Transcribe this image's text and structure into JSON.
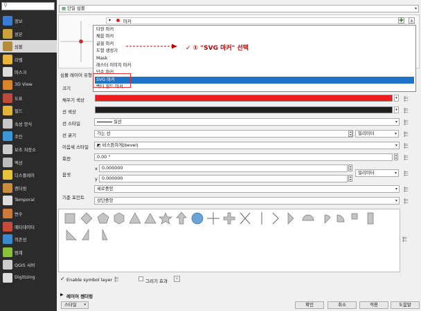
{
  "sidebar": {
    "items": [
      {
        "label": "정보",
        "icon": "info-icon",
        "color": "#3a7bd5"
      },
      {
        "label": "원본",
        "icon": "source-icon",
        "color": "#c9a23a"
      },
      {
        "label": "심볼",
        "icon": "symbology-brush-icon",
        "color": "#b58a3c"
      },
      {
        "label": "라벨",
        "icon": "label-abc-icon",
        "color": "#e8b53a"
      },
      {
        "label": "마스크",
        "icon": "mask-abc-icon",
        "color": "#dddddd"
      },
      {
        "label": "3D View",
        "icon": "3d-view-icon",
        "color": "#d9832a"
      },
      {
        "label": "도표",
        "icon": "diagram-icon",
        "color": "#c04a3a"
      },
      {
        "label": "필드",
        "icon": "fields-icon",
        "color": "#e3b43a"
      },
      {
        "label": "속성 양식",
        "icon": "attributes-form-icon",
        "color": "#c8c8c8"
      },
      {
        "label": "조인",
        "icon": "join-icon",
        "color": "#3a9ad9"
      },
      {
        "label": "보조 저장소",
        "icon": "auxiliary-storage-icon",
        "color": "#cccccc"
      },
      {
        "label": "액션",
        "icon": "action-gear-icon",
        "color": "#bbbbbb"
      },
      {
        "label": "디스플레이",
        "icon": "display-tip-icon",
        "color": "#e8c23a"
      },
      {
        "label": "렌더링",
        "icon": "rendering-brush-icon",
        "color": "#c98c3a"
      },
      {
        "label": "Temporal",
        "icon": "temporal-clock-icon",
        "color": "#dddddd"
      },
      {
        "label": "변수",
        "icon": "variables-icon",
        "color": "#cc7a3a"
      },
      {
        "label": "메타데이터",
        "icon": "metadata-icon",
        "color": "#cc4a3a"
      },
      {
        "label": "의존성",
        "icon": "dependencies-icon",
        "color": "#3a8ad0"
      },
      {
        "label": "범례",
        "icon": "legend-icon",
        "color": "#8abf3a"
      },
      {
        "label": "QGIS 서버",
        "icon": "qgis-server-icon",
        "color": "#cccccc"
      },
      {
        "label": "Digitizing",
        "icon": "digitizing-icon",
        "color": "#dddddd"
      }
    ]
  },
  "header": {
    "renderer": "단일 심볼"
  },
  "symbol_tree": {
    "selected": "마커"
  },
  "dropdown": {
    "items": [
      "타원 마커",
      "채움 마커",
      "글꼴 마커",
      "도형 생성기",
      "Mask",
      "래스터 이미지 마커",
      "단순 마커",
      "SVG 마커",
      "벡터 필드 마커"
    ],
    "highlighted_index": 7
  },
  "annotation": {
    "text": "✓  ① \"SVG 마커\" 선택",
    "color": "#c00000"
  },
  "layer_type_label": "심볼 레이어 유형",
  "props": {
    "size_label": "크기",
    "fill_color_label": "채우기 색상",
    "fill_color": "#ee1c1c",
    "stroke_color_label": "선 색상",
    "stroke_color": "#1e1e1e",
    "stroke_style_label": "선 스타일",
    "stroke_style_value": "실선",
    "stroke_width_label": "선 굵기",
    "stroke_width_value": "가는 선",
    "unit_value": "밀리미터",
    "join_style_label": "이음새 스타일",
    "join_style_value": "비스듬하게(bevel)",
    "rotation_label": "회전",
    "rotation_value": "0.00 °",
    "offset_label": "옵셋",
    "offset_x_label": "x",
    "offset_x": "0.000000",
    "offset_y_label": "y",
    "offset_y": "0.000000",
    "offset_unit": "밀리미터",
    "anchor_label": "기준 포인트",
    "anchor_h": "세로중앙",
    "anchor_v": "상단중앙"
  },
  "bottom": {
    "enable_symbol_layer": "Enable symbol layer",
    "draw_effects": "그리기 효과",
    "layer_rendering": "레이어 렌더링",
    "style_button": "스타일",
    "ok": "확인",
    "cancel": "취소",
    "apply": "적용",
    "help": "도움말"
  }
}
